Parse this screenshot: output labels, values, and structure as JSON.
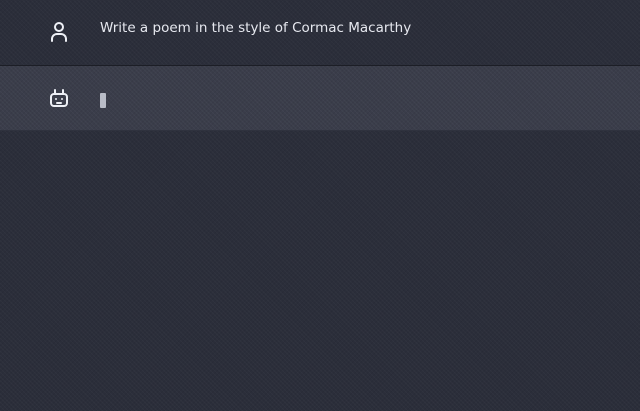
{
  "conversation": {
    "messages": [
      {
        "role": "user",
        "icon": "user-icon",
        "text": "Write a poem in the style of Cormac Macarthy"
      },
      {
        "role": "assistant",
        "icon": "robot-icon",
        "text": "",
        "streaming": true
      }
    ]
  },
  "colors": {
    "background": "#2b2e3a",
    "assistant_row": "#3a3d4a",
    "text": "#e6e8ef",
    "cursor": "#b9bcc7"
  }
}
